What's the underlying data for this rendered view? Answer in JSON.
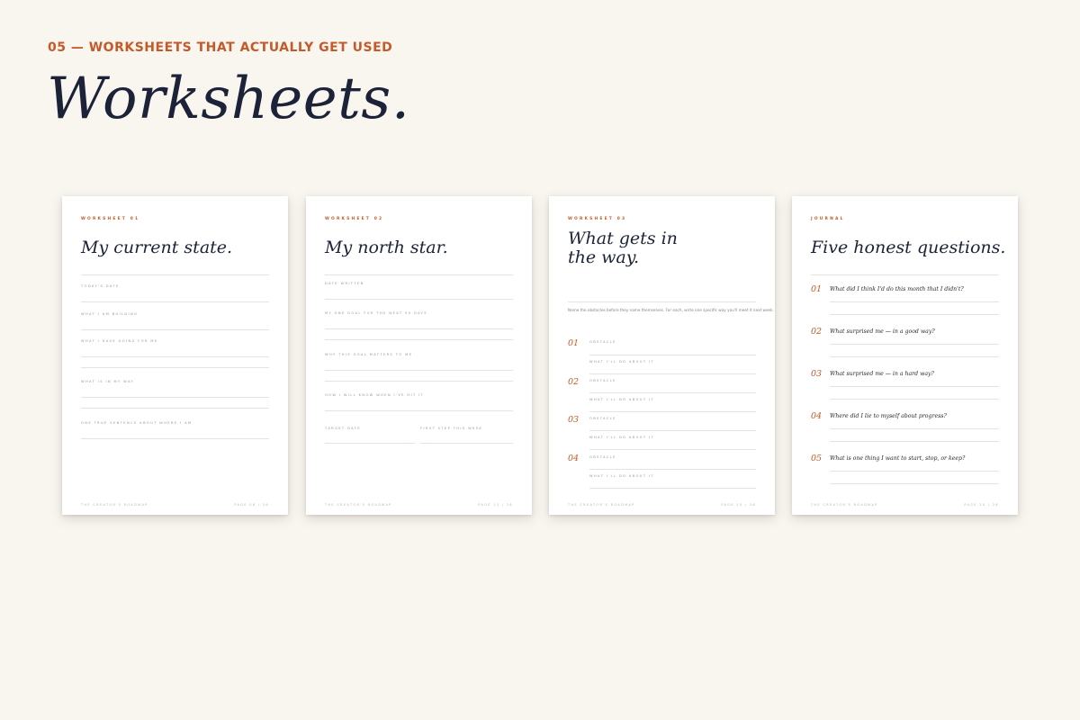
{
  "eyebrow": "05 — WORKSHEETS THAT ACTUALLY GET USED",
  "headline": "Worksheets.",
  "footer_left": "THE CREATOR'S ROADMAP",
  "sheet1": {
    "kicker": "WORKSHEET 01",
    "title": "My current state.",
    "fields": [
      "TODAY'S DATE",
      "WHAT I AM BUILDING",
      "WHAT I HAVE GOING FOR ME",
      "WHAT IS IN MY WAY",
      "ONE TRUE SENTENCE ABOUT WHERE I AM"
    ],
    "page": "PAGE 08 / 26"
  },
  "sheet2": {
    "kicker": "WORKSHEET 02",
    "title": "My north star.",
    "fields": [
      "DATE WRITTEN",
      "MY ONE GOAL FOR THE NEXT 90 DAYS",
      "WHY THIS GOAL MATTERS TO ME",
      "HOW I WILL KNOW WHEN I'VE HIT IT"
    ],
    "target_label": "TARGET DATE",
    "first_step_label": "FIRST STEP THIS WEEK",
    "page": "PAGE 11 / 26"
  },
  "sheet3": {
    "kicker": "WORKSHEET 03",
    "title_line1": "What gets in",
    "title_line2": "the way.",
    "intro": "Name the obstacles before they name themselves. For each, write one specific way you'll meet it next week.",
    "items": [
      {
        "num": "01",
        "a": "OBSTACLE",
        "b": "WHAT I'LL DO ABOUT IT"
      },
      {
        "num": "02",
        "a": "OBSTACLE",
        "b": "WHAT I'LL DO ABOUT IT"
      },
      {
        "num": "03",
        "a": "OBSTACLE",
        "b": "WHAT I'LL DO ABOUT IT"
      },
      {
        "num": "04",
        "a": "OBSTACLE",
        "b": "WHAT I'LL DO ABOUT IT"
      }
    ],
    "page": "PAGE 15 / 26"
  },
  "sheet4": {
    "kicker": "JOURNAL",
    "title": "Five honest questions.",
    "questions": [
      {
        "num": "01",
        "text": "What did I think I'd do this month that I didn't?"
      },
      {
        "num": "02",
        "text": "What surprised me — in a good way?"
      },
      {
        "num": "03",
        "text": "What surprised me — in a hard way?"
      },
      {
        "num": "04",
        "text": "Where did I lie to myself about progress?"
      },
      {
        "num": "05",
        "text": "What is one thing I want to start, stop, or keep?"
      }
    ],
    "page": "PAGE 20 / 26"
  }
}
